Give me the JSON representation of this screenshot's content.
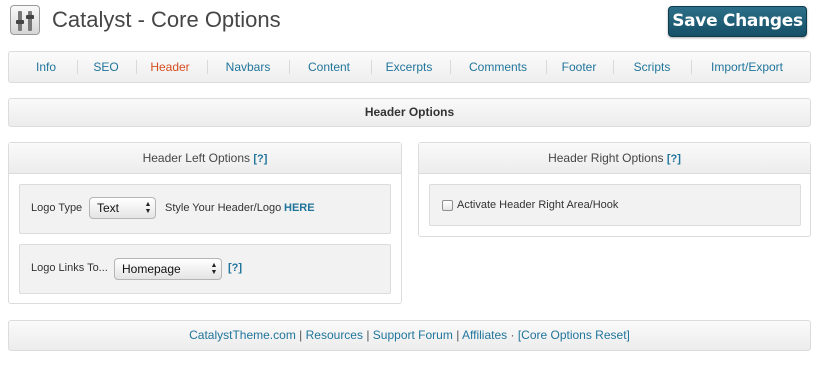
{
  "app": {
    "title": "Catalyst - Core Options",
    "save_label": "Save Changes"
  },
  "tabs": [
    {
      "label": "Info"
    },
    {
      "label": "SEO"
    },
    {
      "label": "Header",
      "active": true
    },
    {
      "label": "Navbars"
    },
    {
      "label": "Content"
    },
    {
      "label": "Excerpts"
    },
    {
      "label": "Comments"
    },
    {
      "label": "Footer"
    },
    {
      "label": "Scripts"
    },
    {
      "label": "Import/Export"
    }
  ],
  "section": {
    "title": "Header Options"
  },
  "left_panel": {
    "title": "Header Left Options",
    "help": "[?]",
    "logo_type": {
      "label": "Logo Type",
      "selected": "Text",
      "style_text": "Style Your Header/Logo",
      "style_link": "HERE"
    },
    "logo_links": {
      "label": "Logo Links To...",
      "selected": "Homepage",
      "help": "[?]"
    }
  },
  "right_panel": {
    "title": "Header Right Options",
    "help": "[?]",
    "activate": {
      "label": "Activate Header Right Area/Hook",
      "checked": false
    }
  },
  "footer": {
    "links": [
      "CatalystTheme.com",
      "Resources",
      "Support Forum",
      "Affiliates",
      "[Core Options Reset]"
    ],
    "sep": "|",
    "sep2": "·"
  },
  "colors": {
    "link": "#21759b",
    "active_tab": "#d54e21",
    "save_button": "#1c5f78"
  },
  "icons": {
    "logo": "settings-sliders-icon",
    "select_arrows": "updown-arrows-icon"
  }
}
